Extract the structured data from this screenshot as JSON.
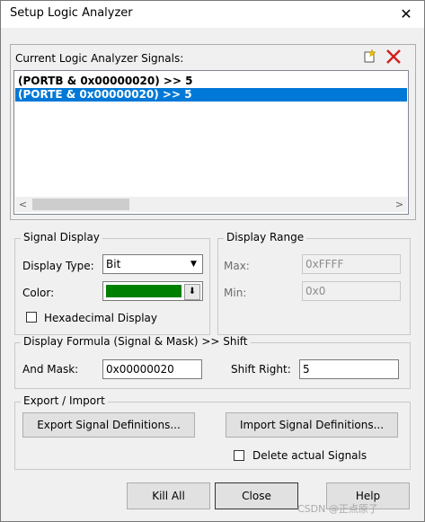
{
  "window": {
    "title": "Setup Logic Analyzer"
  },
  "signals_panel": {
    "label": "Current Logic Analyzer Signals:",
    "items": [
      {
        "text": "(PORTB & 0x00000020) >> 5",
        "selected": false
      },
      {
        "text": "(PORTE & 0x00000020) >> 5",
        "selected": true
      }
    ]
  },
  "signal_display": {
    "legend": "Signal Display",
    "display_type_label": "Display Type:",
    "display_type_value": "Bit",
    "color_label": "Color:",
    "color_value": "#008000",
    "hex_label": "Hexadecimal Display",
    "hex_checked": false
  },
  "display_range": {
    "legend": "Display Range",
    "max_label": "Max:",
    "max_value": "0xFFFF",
    "min_label": "Min:",
    "min_value": "0x0"
  },
  "formula": {
    "legend": "Display Formula (Signal & Mask) >> Shift",
    "and_mask_label": "And Mask:",
    "and_mask_value": "0x00000020",
    "shift_label": "Shift Right:",
    "shift_value": "5"
  },
  "export_import": {
    "legend": "Export / Import",
    "export_label": "Export Signal Definitions...",
    "import_label": "Import Signal Definitions...",
    "delete_label": "Delete actual Signals",
    "delete_checked": false
  },
  "buttons": {
    "kill_all": "Kill All",
    "close": "Close",
    "help": "Help"
  },
  "watermark": "CSDN @正点原子"
}
